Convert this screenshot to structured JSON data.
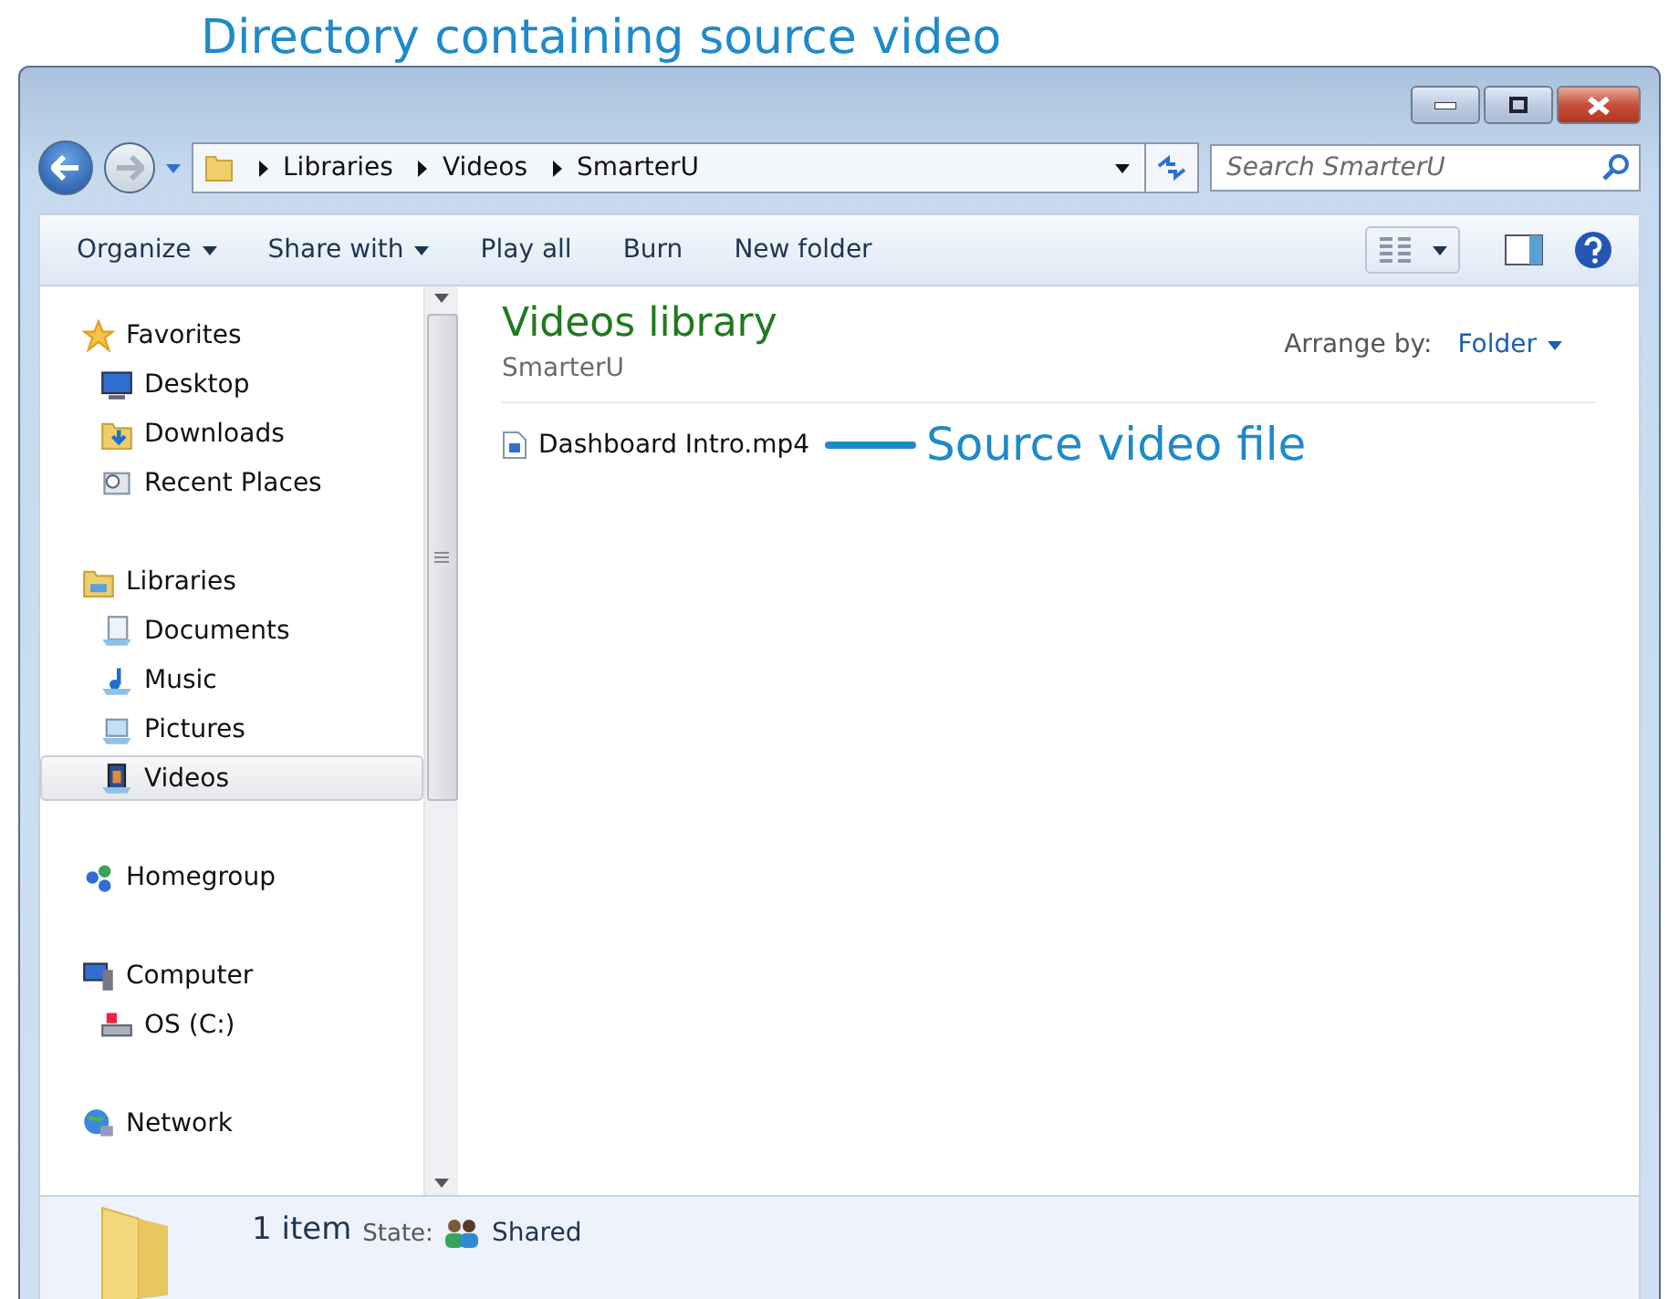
{
  "annotations": {
    "top": "Directory containing source video"
  },
  "address": {
    "crumbs": [
      "Libraries",
      "Videos",
      "SmarterU"
    ]
  },
  "search": {
    "placeholder": "Search SmarterU"
  },
  "toolbar": {
    "buttons": [
      {
        "label": "Organize",
        "dropdown": true
      },
      {
        "label": "Share with",
        "dropdown": true
      },
      {
        "label": "Play all",
        "dropdown": false
      },
      {
        "label": "Burn",
        "dropdown": false
      },
      {
        "label": "New folder",
        "dropdown": false
      }
    ]
  },
  "sidebar": {
    "groups": [
      {
        "label": "Favorites",
        "selected": false,
        "children": [
          {
            "label": "Desktop",
            "selected": false
          },
          {
            "label": "Downloads",
            "selected": false
          },
          {
            "label": "Recent Places",
            "selected": false
          }
        ]
      },
      {
        "label": "Libraries",
        "selected": false,
        "children": [
          {
            "label": "Documents",
            "selected": false
          },
          {
            "label": "Music",
            "selected": false
          },
          {
            "label": "Pictures",
            "selected": false
          },
          {
            "label": "Videos",
            "selected": true
          }
        ]
      },
      {
        "label": "Homegroup",
        "selected": false
      },
      {
        "label": "Computer",
        "selected": false,
        "children": [
          {
            "label": "OS (C:)",
            "selected": false
          }
        ]
      },
      {
        "label": "Network",
        "selected": false
      }
    ]
  },
  "library": {
    "title": "Videos library",
    "subtitle": "SmarterU",
    "arrange_label": "Arrange by:",
    "arrange_value": "Folder"
  },
  "files": [
    {
      "name": "Dashboard Intro.mp4",
      "annotation": "Source video file"
    }
  ],
  "status": {
    "count": "1 item",
    "state_label": "State:",
    "state_value": "Shared"
  }
}
